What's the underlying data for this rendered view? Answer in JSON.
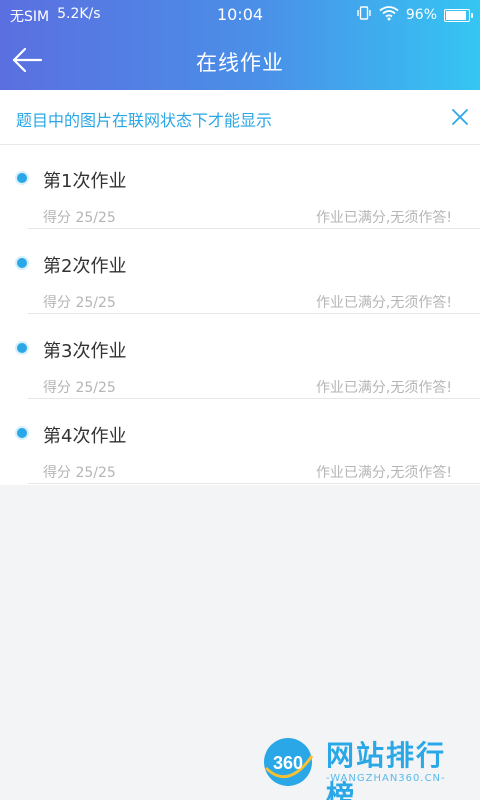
{
  "status_bar": {
    "carrier": "无SIM",
    "speed": "5.2K/s",
    "time": "10:04",
    "battery_percent": "96%",
    "battery_level": 0.96
  },
  "navbar": {
    "title": "在线作业",
    "back_icon": "arrow-left-icon"
  },
  "notice": {
    "text": "题目中的图片在联网状态下才能显示",
    "close_icon": "close-icon"
  },
  "homework": [
    {
      "title": "第1次作业",
      "score": "得分 25/25",
      "status": "作业已满分,无须作答!"
    },
    {
      "title": "第2次作业",
      "score": "得分 25/25",
      "status": "作业已满分,无须作答!"
    },
    {
      "title": "第3次作业",
      "score": "得分 25/25",
      "status": "作业已满分,无须作答!"
    },
    {
      "title": "第4次作业",
      "score": "得分 25/25",
      "status": "作业已满分,无须作答!"
    }
  ],
  "watermark": {
    "logo_text": "360",
    "title": "网站排行榜",
    "url": "-WANGZHAN360.CN-"
  },
  "colors": {
    "accent": "#2aa7e6",
    "header_start": "#5b6fe0",
    "header_end": "#35c6f3"
  }
}
